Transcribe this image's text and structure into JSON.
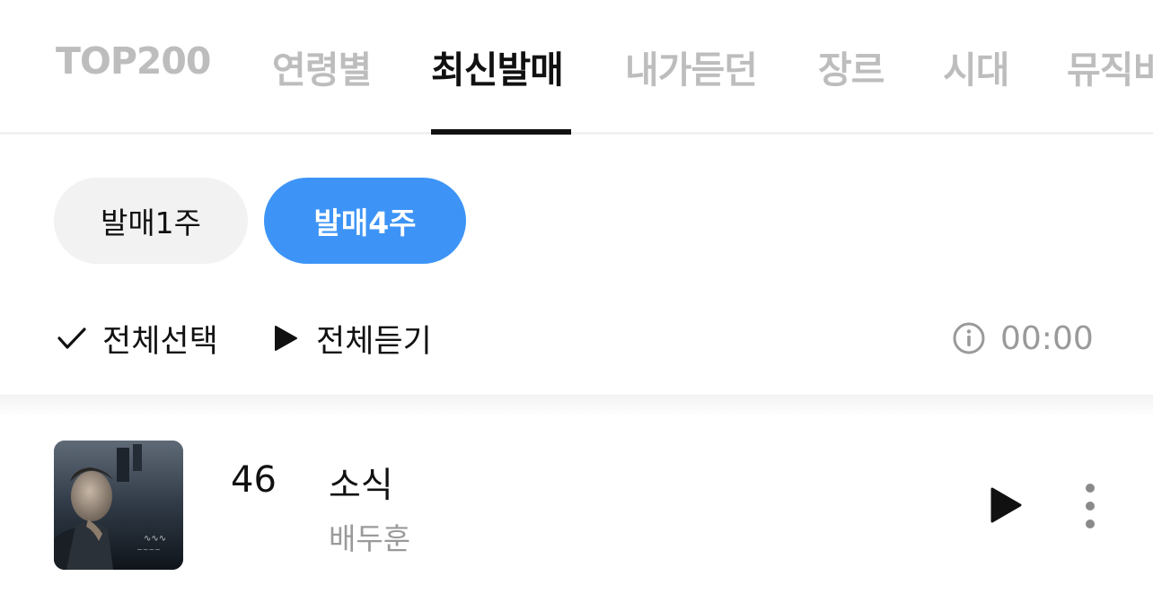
{
  "tabs": [
    {
      "label": "TOP200",
      "active": false
    },
    {
      "label": "연령별",
      "active": false
    },
    {
      "label": "최신발매",
      "active": true
    },
    {
      "label": "내가듣던",
      "active": false
    },
    {
      "label": "장르",
      "active": false
    },
    {
      "label": "시대",
      "active": false
    },
    {
      "label": "뮤직비",
      "active": false
    }
  ],
  "filters": {
    "week1_label": "발매1주",
    "week4_label": "발매4주",
    "selected": "발매4주"
  },
  "actions": {
    "select_all_label": "전체선택",
    "play_all_label": "전체듣기",
    "total_time": "00:00"
  },
  "songs": [
    {
      "rank": "46",
      "title": "소식",
      "artist": "배두훈"
    }
  ],
  "colors": {
    "accent": "#3d94f6",
    "active_text": "#111111",
    "inactive_tab": "#bdbdbd",
    "secondary_text": "#9a9a9a",
    "pill_inactive_bg": "#f2f2f2"
  },
  "icons": {
    "select_all": "check-icon",
    "play_all": "play-icon",
    "info": "info-icon",
    "song_play": "play-icon",
    "song_more": "more-vertical-icon"
  }
}
